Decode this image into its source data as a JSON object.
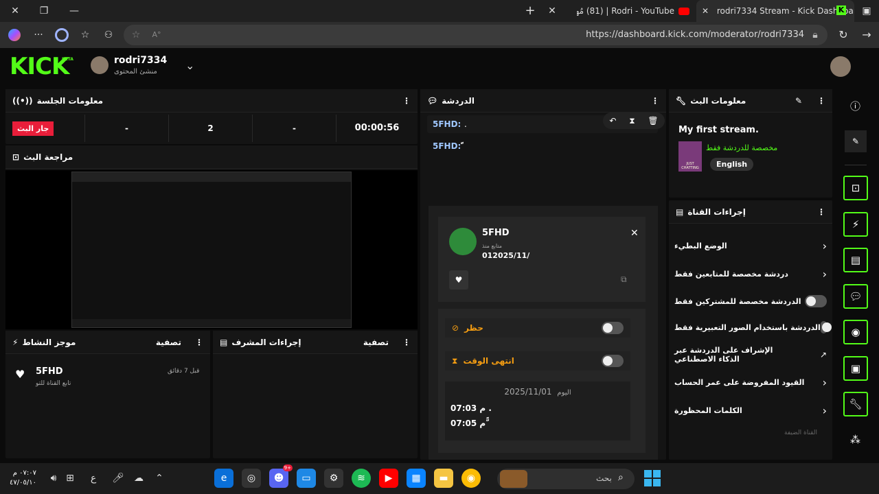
{
  "browser": {
    "tabs": [
      {
        "title": "Rodri - YouTube | ‫(81) مُهند‬"
      },
      {
        "title": "rodri7334 Stream - Kick Dashboard"
      }
    ],
    "url": "https://dashboard.kick.com/moderator/rodri7334"
  },
  "app": {
    "logo": "KICK",
    "logo_badge": "BETA",
    "username": "rodri7334",
    "role": "منشئ المحتوى"
  },
  "session": {
    "title": "معلومات الجلسة",
    "live_badge": "جار البث",
    "stats": [
      "-",
      "2",
      "-",
      "00:00:56"
    ]
  },
  "preview": {
    "title": "مراجعة البث"
  },
  "activity": {
    "title": "موجز النشاط",
    "filter": "تصفية",
    "item_user": "5FHD",
    "item_text": "تابع القناة للتو",
    "item_time": "قبل 7 دقائق"
  },
  "mod_actions": {
    "title": "إجراءات المشرف",
    "filter": "تصفية"
  },
  "chat": {
    "title": "الدردشة",
    "messages": [
      {
        "user": "5FHD:",
        "text": "."
      },
      {
        "user": "5FHD:",
        "text": "ًّ"
      }
    ],
    "usercard": {
      "name": "5FHD",
      "following_label": "متابع منذ",
      "following_date": "012025/11/",
      "ban_label": "حظر",
      "timeout_label": "انتهى الوقت",
      "date_day": "اليوم",
      "date": "2025/11/01",
      "times": [
        "07:03 م .",
        "07:05 م ًّ"
      ]
    }
  },
  "stream_info": {
    "title": "معلومات البث",
    "stream_title": "My first stream.",
    "category": "مخصصة للدردشة فقط",
    "language": "English",
    "thumb_text": "JUST CHATTING"
  },
  "channel_actions": {
    "title": "إجراءات القناة",
    "items": [
      {
        "label": "الوضع البطيء",
        "control": "chevron"
      },
      {
        "label": "دردشة مخصصة للمتابعين فقط",
        "control": "chevron"
      },
      {
        "label": "الدردشة مخصصة للمشتركين فقط",
        "control": "toggle"
      },
      {
        "label": "الدردشة باستخدام الصور التعبيرية فقط",
        "control": "toggle"
      },
      {
        "label": "الإشراف على الدردشة عبر الذكاء الاصطناعي",
        "control": "external"
      },
      {
        "label": "القيود المفروضة على عمر الحساب",
        "control": "chevron"
      },
      {
        "label": "الكلمات المحظورة",
        "control": "chevron"
      }
    ],
    "section_label": "القناة الضيفة"
  },
  "taskbar": {
    "search_placeholder": "بحث",
    "clock_time": "٠٧:٠٧ م",
    "clock_date": "٤٧/٠٥/١٠",
    "lang": "ع",
    "discord_badge": "9+"
  },
  "colors": {
    "accent": "#53fc18",
    "live": "#e91e3a",
    "warning": "#f39c12"
  }
}
